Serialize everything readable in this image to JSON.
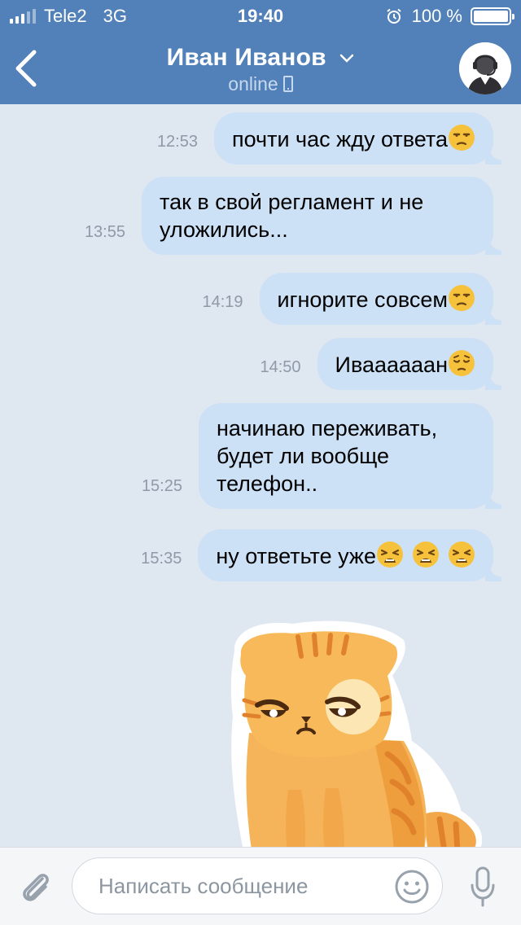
{
  "status_bar": {
    "carrier": "Tele2",
    "network": "3G",
    "time": "19:40",
    "battery": "100 %"
  },
  "header": {
    "contact_name": "Иван Иванов",
    "status": "online",
    "colors": {
      "bar": "#5181b8",
      "bubble": "#cce0f6",
      "background": "#dfe7f1"
    }
  },
  "messages": [
    {
      "time": "12:53",
      "text": "почти час жду ответа",
      "emoji": [
        "unamused"
      ]
    },
    {
      "time": "13:55",
      "text": "так в свой регламент и не уложились...",
      "emoji": []
    },
    {
      "time": "14:19",
      "text": "игнорите совсем",
      "emoji": [
        "unamused"
      ]
    },
    {
      "time": "14:50",
      "text": "Иваааааан",
      "emoji": [
        "pensive"
      ]
    },
    {
      "time": "15:25",
      "text": "начинаю переживать, будет ли вообще телефон..",
      "emoji": []
    },
    {
      "time": "15:35",
      "text": "ну ответьте уже",
      "emoji": [
        "weary",
        "weary",
        "weary"
      ]
    }
  ],
  "sticker": {
    "icon": "sad-orange-cat-sticker"
  },
  "input_bar": {
    "placeholder": "Написать сообщение"
  }
}
